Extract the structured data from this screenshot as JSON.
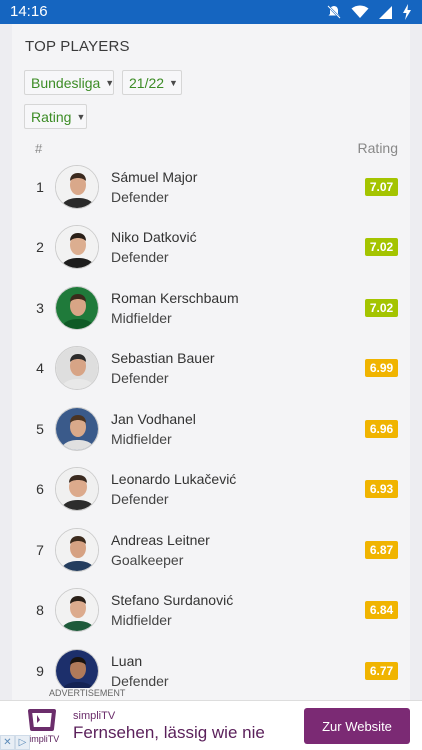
{
  "status_bar": {
    "time": "14:16"
  },
  "section": {
    "title": "TOP PLAYERS"
  },
  "filters": {
    "league": "Bundesliga",
    "season": "21/22",
    "sort": "Rating"
  },
  "table_header": {
    "rank": "#",
    "rating": "Rating"
  },
  "players": [
    {
      "rank": "1",
      "name": "Sámuel Major",
      "position": "Defender",
      "rating": "7.07",
      "badge_color": "#a4c400"
    },
    {
      "rank": "2",
      "name": "Niko Datković",
      "position": "Defender",
      "rating": "7.02",
      "badge_color": "#a4c400"
    },
    {
      "rank": "3",
      "name": "Roman Kerschbaum",
      "position": "Midfielder",
      "rating": "7.02",
      "badge_color": "#a4c400"
    },
    {
      "rank": "4",
      "name": "Sebastian Bauer",
      "position": "Defender",
      "rating": "6.99",
      "badge_color": "#f0b400"
    },
    {
      "rank": "5",
      "name": "Jan Vodhanel",
      "position": "Midfielder",
      "rating": "6.96",
      "badge_color": "#f0b400"
    },
    {
      "rank": "6",
      "name": "Leonardo Lukačević",
      "position": "Defender",
      "rating": "6.93",
      "badge_color": "#f0b400"
    },
    {
      "rank": "7",
      "name": "Andreas Leitner",
      "position": "Goalkeeper",
      "rating": "6.87",
      "badge_color": "#f0b400"
    },
    {
      "rank": "8",
      "name": "Stefano Surdanović",
      "position": "Midfielder",
      "rating": "6.84",
      "badge_color": "#f0b400"
    },
    {
      "rank": "9",
      "name": "Luan",
      "position": "Defender",
      "rating": "6.77",
      "badge_color": "#f0b400"
    }
  ],
  "ad": {
    "label": "ADVERTISEMENT",
    "logo_text": "simpliTV",
    "brand": "simpliTV",
    "slogan": "Fernsehen, lässig wie nie",
    "cta": "Zur Website"
  },
  "colors": {
    "status_bar": "#1565c0",
    "accent_green": "#3c8c25",
    "cta": "#7b2a74"
  }
}
